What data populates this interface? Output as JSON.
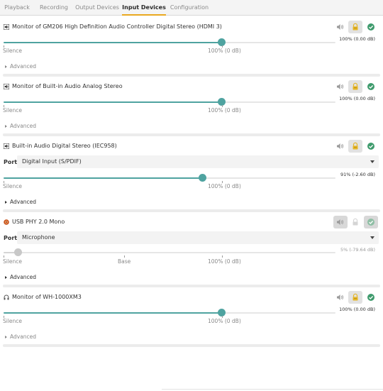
{
  "tabs": [
    {
      "label": "Playback",
      "active": false
    },
    {
      "label": "Recording",
      "active": false
    },
    {
      "label": "Output Devices",
      "active": false
    },
    {
      "label": "Input Devices",
      "active": true
    },
    {
      "label": "Configuration",
      "active": false
    }
  ],
  "colors": {
    "accent": "#4fa3a0",
    "tab_underline": "#e9a81f",
    "lock_yellow": "#e5b626",
    "ok_green": "#3f9b6d"
  },
  "devices": [
    {
      "name": "Monitor of GM206 High Definition Audio Controller Digital Stereo (HDMI 3)",
      "icon": "monitor-speaker-icon",
      "level_fraction": 1.0,
      "level_readout": "100% (0.00 dB)",
      "marks": {
        "silence": "Silence",
        "full": "100% (0 dB)"
      },
      "advanced": "Advanced"
    },
    {
      "name": "Monitor of Built-in Audio Analog Stereo",
      "icon": "monitor-speaker-icon",
      "level_fraction": 1.0,
      "level_readout": "100% (0.00 dB)",
      "marks": {
        "silence": "Silence",
        "full": "100% (0 dB)"
      },
      "advanced": "Advanced"
    },
    {
      "name": "Built-in Audio Digital Stereo (IEC958)",
      "icon": "monitor-speaker-icon",
      "port_label": "Port:",
      "port_value": "Digital Input (S/PDIF)",
      "level_fraction": 0.91,
      "level_readout": "91% (-2.60 dB)",
      "marks": {
        "silence": "Silence",
        "full": "100% (0 dB)"
      },
      "advanced": "Advanced"
    },
    {
      "name": "USB PHY 2.0 Mono",
      "icon": "usb-audio-icon",
      "port_label": "Port:",
      "port_value": "Microphone",
      "level_fraction": 0.05,
      "level_readout": "5% (-79.64 dB)",
      "muted": true,
      "marks": {
        "silence": "Silence",
        "base": "Base",
        "full": "100% (0 dB)"
      },
      "advanced": "Advanced"
    },
    {
      "name": "Monitor of WH-1000XM3",
      "icon": "headphones-icon",
      "level_fraction": 1.0,
      "level_readout": "100% (0.00 dB)",
      "marks": {
        "silence": "Silence",
        "full": "100% (0 dB)"
      },
      "advanced": "Advanced"
    }
  ]
}
